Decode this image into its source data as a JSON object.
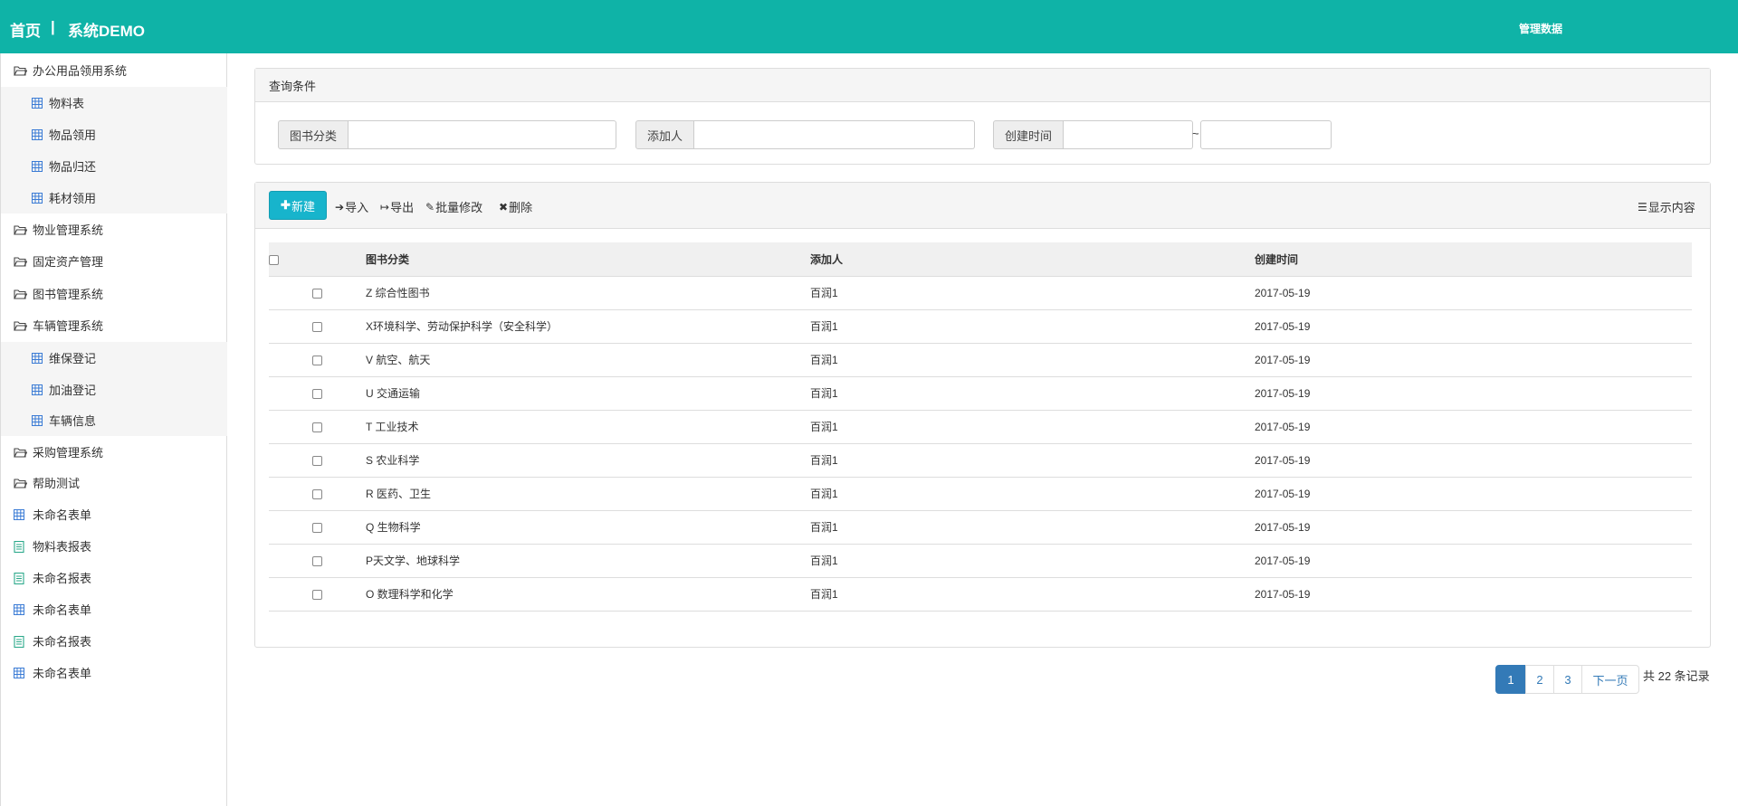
{
  "header": {
    "home": "首页",
    "separator": "|",
    "system": "系统DEMO",
    "admin": "管理数据"
  },
  "sidebar": {
    "items": [
      {
        "label": "办公用品领用系统",
        "type": "folder",
        "level": "top"
      },
      {
        "label": "物料表",
        "type": "table",
        "level": "sub"
      },
      {
        "label": "物品领用",
        "type": "table",
        "level": "sub"
      },
      {
        "label": "物品归还",
        "type": "table",
        "level": "sub"
      },
      {
        "label": "耗材领用",
        "type": "table",
        "level": "sub"
      },
      {
        "label": "物业管理系统",
        "type": "folder",
        "level": "top"
      },
      {
        "label": "固定资产管理",
        "type": "folder",
        "level": "top"
      },
      {
        "label": "图书管理系统",
        "type": "folder",
        "level": "top"
      },
      {
        "label": "车辆管理系统",
        "type": "folder",
        "level": "top"
      },
      {
        "label": "维保登记",
        "type": "table",
        "level": "sub"
      },
      {
        "label": "加油登记",
        "type": "table",
        "level": "sub"
      },
      {
        "label": "车辆信息",
        "type": "table",
        "level": "sub"
      },
      {
        "label": "采购管理系统",
        "type": "folder",
        "level": "top"
      },
      {
        "label": "帮助测试",
        "type": "folder",
        "level": "top"
      },
      {
        "label": "未命名表单",
        "type": "table",
        "level": "top"
      },
      {
        "label": "物料表报表",
        "type": "report",
        "level": "top"
      },
      {
        "label": "未命名报表",
        "type": "report",
        "level": "top"
      },
      {
        "label": "未命名表单",
        "type": "table",
        "level": "top"
      },
      {
        "label": "未命名报表",
        "type": "report",
        "level": "top"
      },
      {
        "label": "未命名表单",
        "type": "table",
        "level": "top"
      }
    ]
  },
  "query": {
    "title": "查询条件",
    "category_label": "图书分类",
    "adder_label": "添加人",
    "created_label": "创建时间",
    "range_sep": "~",
    "category_value": "",
    "adder_value": "",
    "created_from": "",
    "created_to": ""
  },
  "toolbar": {
    "new_label": "新建",
    "import_label": "导入",
    "export_label": "导出",
    "batch_edit_label": "批量修改",
    "delete_label": "删除",
    "display_label": "显示内容"
  },
  "table": {
    "headers": [
      "图书分类",
      "添加人",
      "创建时间"
    ],
    "rows": [
      [
        "Z 综合性图书",
        "百润1",
        "2017-05-19"
      ],
      [
        "X环境科学、劳动保护科学（安全科学）",
        "百润1",
        "2017-05-19"
      ],
      [
        "V 航空、航天",
        "百润1",
        "2017-05-19"
      ],
      [
        "U 交通运输",
        "百润1",
        "2017-05-19"
      ],
      [
        "T 工业技术",
        "百润1",
        "2017-05-19"
      ],
      [
        "S 农业科学",
        "百润1",
        "2017-05-19"
      ],
      [
        "R 医药、卫生",
        "百润1",
        "2017-05-19"
      ],
      [
        "Q 生物科学",
        "百润1",
        "2017-05-19"
      ],
      [
        "P天文学、地球科学",
        "百润1",
        "2017-05-19"
      ],
      [
        "O 数理科学和化学",
        "百润1",
        "2017-05-19"
      ]
    ]
  },
  "pagination": {
    "pages": [
      "1",
      "2",
      "3"
    ],
    "current": "1",
    "next_label": "下一页",
    "total_text": "共 22 条记录"
  },
  "colors": {
    "header_bg": "#0fb3a7",
    "new_button": "#17b4cc",
    "page_active": "#337ab7",
    "table_icon": "#3a7bd5",
    "report_icon": "#2ba88a"
  }
}
